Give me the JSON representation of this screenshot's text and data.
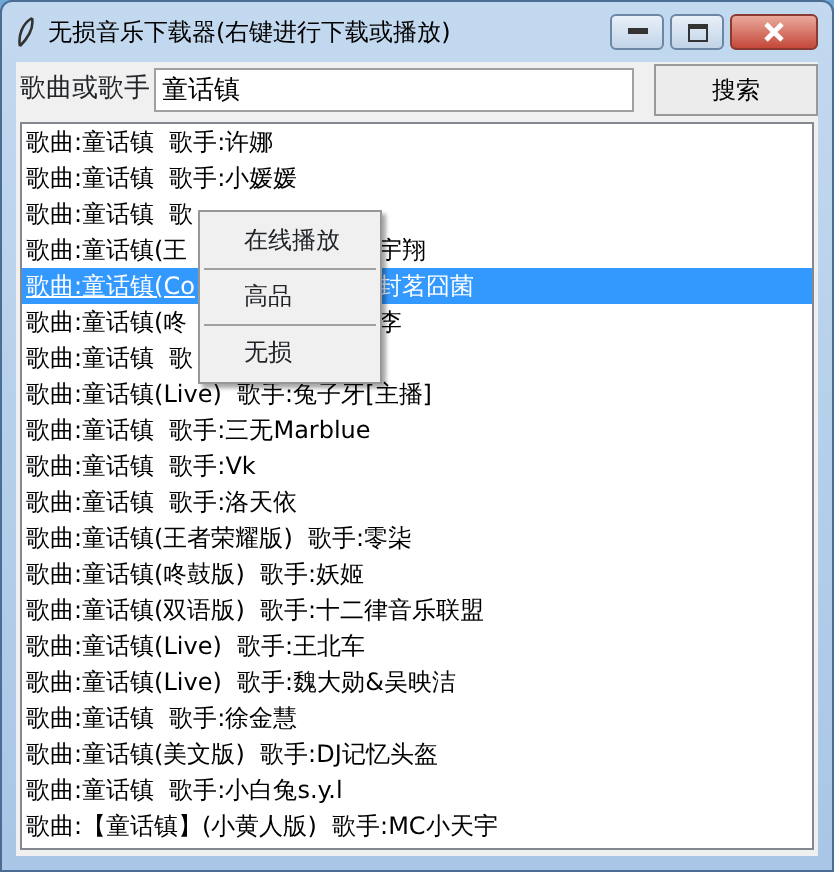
{
  "window": {
    "title": "无损音乐下载器(右键进行下载或播放)"
  },
  "search": {
    "label": "歌曲或歌手",
    "value": "童话镇",
    "button": "搜索"
  },
  "results": [
    {
      "text": "歌曲:童话镇  歌手:许娜",
      "selected": false
    },
    {
      "text": "歌曲:童话镇  歌手:小媛媛",
      "selected": false
    },
    {
      "text": "歌曲:童话镇  歌",
      "selected": false
    },
    {
      "text": "歌曲:童话镇(王",
      "text_after": "宇翔",
      "selected": false
    },
    {
      "text": "歌曲:童话镇(Co",
      "text_after": "封茗囧菌",
      "selected": true
    },
    {
      "text": "歌曲:童话镇(咚",
      "text_after": "李",
      "selected": false
    },
    {
      "text": "歌曲:童话镇  歌",
      "selected": false
    },
    {
      "text": "歌曲:童话镇(Live)  歌手:兔子牙[主播]",
      "selected": false
    },
    {
      "text": "歌曲:童话镇  歌手:三无Marblue",
      "selected": false
    },
    {
      "text": "歌曲:童话镇  歌手:Vk",
      "selected": false
    },
    {
      "text": "歌曲:童话镇  歌手:洛天依",
      "selected": false
    },
    {
      "text": "歌曲:童话镇(王者荣耀版)  歌手:零柒",
      "selected": false
    },
    {
      "text": "歌曲:童话镇(咚鼓版)  歌手:妖姬",
      "selected": false
    },
    {
      "text": "歌曲:童话镇(双语版)  歌手:十二律音乐联盟",
      "selected": false
    },
    {
      "text": "歌曲:童话镇(Live)  歌手:王北车",
      "selected": false
    },
    {
      "text": "歌曲:童话镇(Live)  歌手:魏大勋&吴映洁",
      "selected": false
    },
    {
      "text": "歌曲:童话镇  歌手:徐金慧",
      "selected": false
    },
    {
      "text": "歌曲:童话镇(美文版)  歌手:DJ记忆头盔",
      "selected": false
    },
    {
      "text": "歌曲:童话镇  歌手:小白兔s.y.l",
      "selected": false
    },
    {
      "text": "歌曲:【童话镇】(小黄人版)  歌手:MC小天宇",
      "selected": false
    }
  ],
  "context_menu": [
    "在线播放",
    "高品",
    "无损"
  ]
}
